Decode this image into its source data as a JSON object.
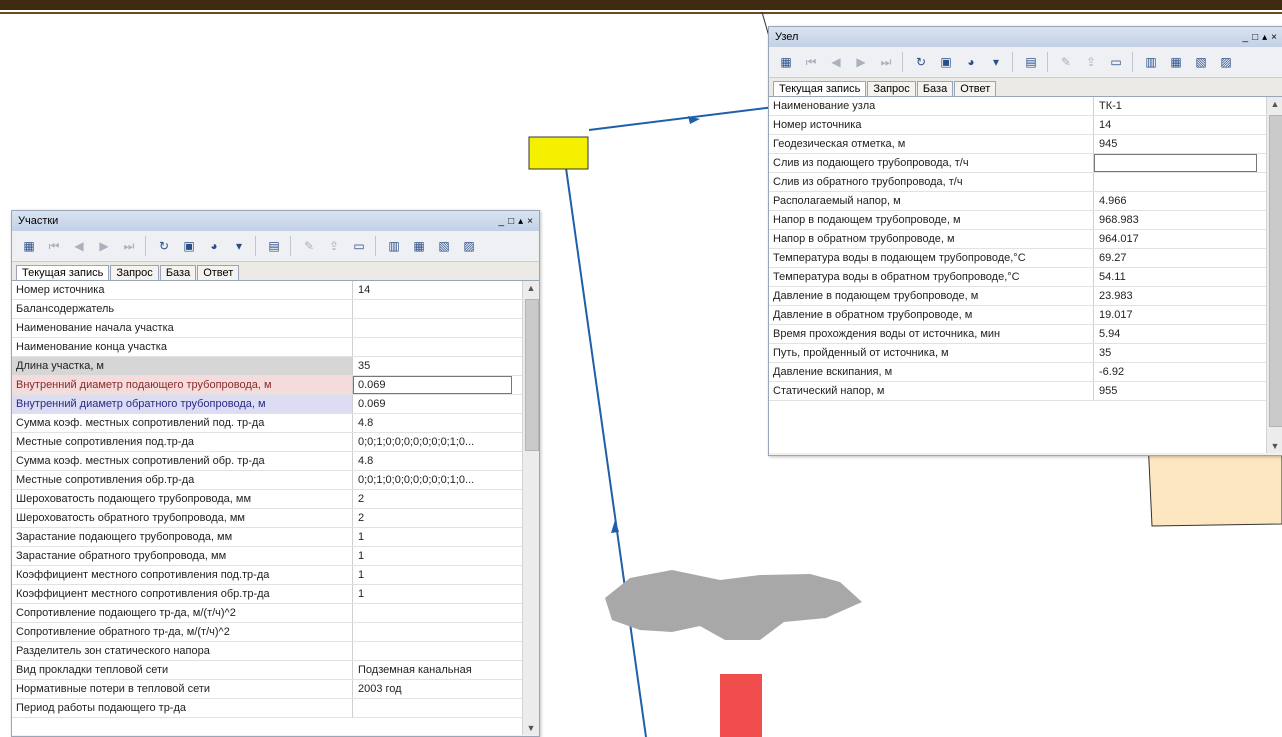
{
  "left_window": {
    "title": "Участки",
    "controls": [
      "_",
      "□",
      "▴",
      "×"
    ],
    "tabs": [
      "Текущая запись",
      "Запрос",
      "База",
      "Ответ"
    ],
    "rows": [
      {
        "label": "Номер источника",
        "value": "14"
      },
      {
        "label": "Балансодержатель",
        "value": ""
      },
      {
        "label": "Наименование начала участка",
        "value": ""
      },
      {
        "label": "Наименование конца участка",
        "value": ""
      },
      {
        "label": "Длина участка, м",
        "value": "35"
      },
      {
        "label": "Внутренний диаметр подающего трубопровода, м",
        "value": "0.069"
      },
      {
        "label": "Внутренний диаметр обратного трубопровода, м",
        "value": "0.069"
      },
      {
        "label": "Сумма коэф. местных сопротивлений под. тр-да",
        "value": "4.8"
      },
      {
        "label": "Местные сопротивления под.тр-да",
        "value": "0;0;1;0;0;0;0;0;0;0;1;0..."
      },
      {
        "label": "Сумма коэф. местных сопротивлений обр. тр-да",
        "value": "4.8"
      },
      {
        "label": "Местные сопротивления обр.тр-да",
        "value": "0;0;1;0;0;0;0;0;0;0;1;0..."
      },
      {
        "label": "Шероховатость подающего трубопровода, мм",
        "value": "2"
      },
      {
        "label": "Шероховатость обратного трубопровода, мм",
        "value": "2"
      },
      {
        "label": "Зарастание подающего трубопровода, мм",
        "value": "1"
      },
      {
        "label": "Зарастание обратного трубопровода, мм",
        "value": "1"
      },
      {
        "label": "Коэффициент местного сопротивления под.тр-да",
        "value": "1"
      },
      {
        "label": "Коэффициент местного сопротивления обр.тр-да",
        "value": "1"
      },
      {
        "label": "Сопротивление подающего тр-да, м/(т/ч)^2",
        "value": ""
      },
      {
        "label": "Сопротивление обратного тр-да, м/(т/ч)^2",
        "value": ""
      },
      {
        "label": "Разделитель зон статического напора",
        "value": ""
      },
      {
        "label": "Вид прокладки тепловой сети",
        "value": "Подземная канальная"
      },
      {
        "label": "Нормативные потери в тепловой сети",
        "value": "2003 год"
      },
      {
        "label": "Период работы подающего тр-да",
        "value": ""
      }
    ]
  },
  "right_window": {
    "title": "Узел",
    "controls": [
      "_",
      "□",
      "▴",
      "×"
    ],
    "tabs": [
      "Текущая запись",
      "Запрос",
      "База",
      "Ответ"
    ],
    "rows": [
      {
        "label": "Наименование узла",
        "value": "ТК-1"
      },
      {
        "label": "Номер источника",
        "value": "14"
      },
      {
        "label": "Геодезическая отметка, м",
        "value": "945"
      },
      {
        "label": "Слив из подающего трубопровода, т/ч",
        "value": ""
      },
      {
        "label": "Слив из обратного трубопровода, т/ч",
        "value": ""
      },
      {
        "label": "Располагаемый напор, м",
        "value": "4.966"
      },
      {
        "label": "Напор в подающем трубопроводе, м",
        "value": "968.983"
      },
      {
        "label": "Напор в обратном трубопроводе, м",
        "value": "964.017"
      },
      {
        "label": "Температура воды в подающем трубопроводе,°С",
        "value": "69.27"
      },
      {
        "label": "Температура воды в обратном трубопроводе,°С",
        "value": "54.11"
      },
      {
        "label": "Давление в подающем трубопроводе, м",
        "value": "23.983"
      },
      {
        "label": "Давление в обратном трубопроводе, м",
        "value": "19.017"
      },
      {
        "label": "Время прохождения воды от источника, мин",
        "value": "5.94"
      },
      {
        "label": "Путь, пройденный от источника, м",
        "value": "35"
      },
      {
        "label": "Давление вскипания, м",
        "value": "-6.92"
      },
      {
        "label": "Статический напор, м",
        "value": "955"
      }
    ]
  },
  "colors": {
    "pipe": "#1f5fa8",
    "node": "#f5f000",
    "red_object": "#f24d4d",
    "gray_object": "#a8a8a8",
    "building": "#fde7c0"
  }
}
